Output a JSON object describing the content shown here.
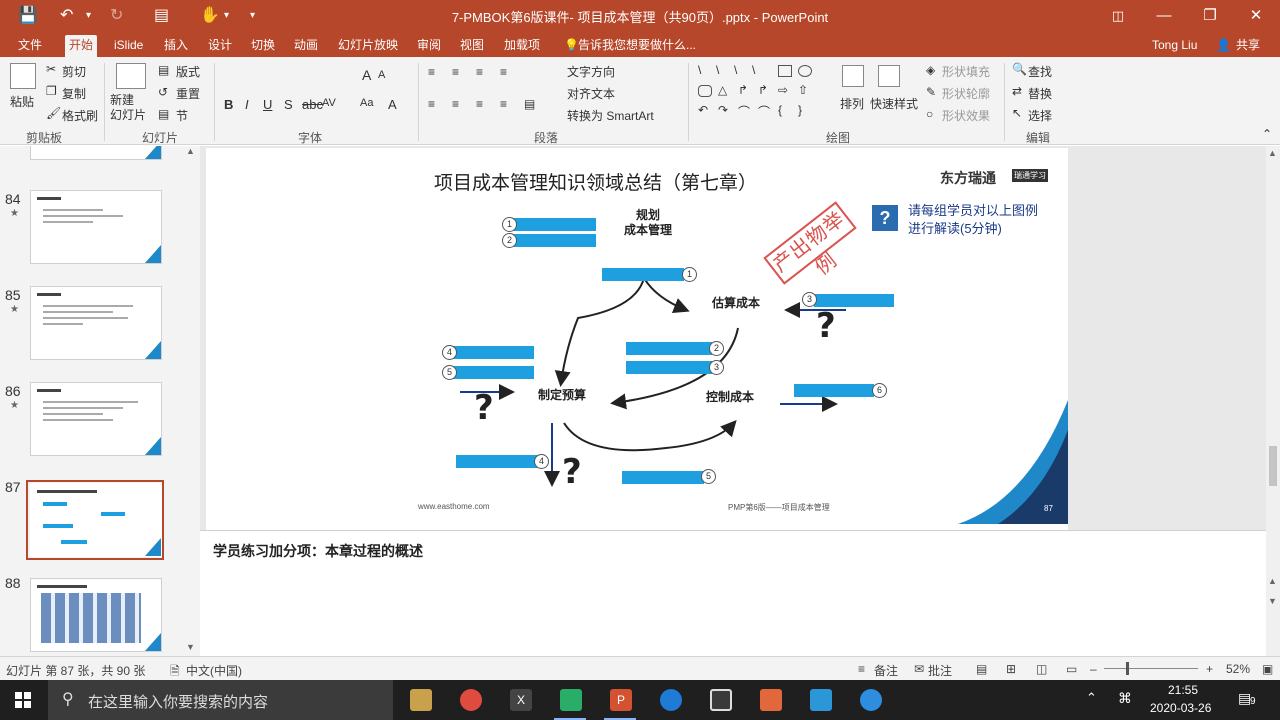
{
  "window": {
    "title": "7-PMBOK第6版课件- 项目成本管理（共90页）.pptx - PowerPoint",
    "user": "Tong Liu",
    "share_label": "共享"
  },
  "tabs": [
    "文件",
    "开始",
    "iSlide",
    "插入",
    "设计",
    "切换",
    "动画",
    "幻灯片放映",
    "审阅",
    "视图",
    "加载项"
  ],
  "tell_me": "告诉我您想要做什么...",
  "ribbon": {
    "clipboard": {
      "paste": "粘贴",
      "cut": "剪切",
      "copy": "复制",
      "format_painter": "格式刷",
      "label": "剪贴板"
    },
    "slides": {
      "new_slide": "新建\n幻灯片",
      "layout": "版式",
      "reset": "重置",
      "section": "节",
      "label": "幻灯片"
    },
    "font": {
      "label": "字体"
    },
    "paragraph": {
      "text_direction": "文字方向",
      "align_text": "对齐文本",
      "smartart": "转换为 SmartArt",
      "label": "段落"
    },
    "drawing": {
      "arrange": "排列",
      "quick_styles": "快速样式",
      "shape_fill": "形状填充",
      "shape_outline": "形状轮廓",
      "shape_effects": "形状效果",
      "label": "绘图"
    },
    "editing": {
      "find": "查找",
      "replace": "替换",
      "select": "选择",
      "label": "编辑"
    }
  },
  "thumbnails": [
    {
      "num": "84",
      "star": "★"
    },
    {
      "num": "85",
      "star": "★"
    },
    {
      "num": "86",
      "star": "★"
    },
    {
      "num": "87",
      "star": "",
      "selected": true
    },
    {
      "num": "88",
      "star": ""
    }
  ],
  "slide": {
    "title": "项目成本管理知识领域总结（第七章）",
    "logo": "东方瑞通",
    "logo_sub": "瑞通学习",
    "prompt": "请每组学员对以上图例\n进行解读(5分钟)",
    "stamp": "产出物举例",
    "process_plan": "规划\n成本管理",
    "process_estimate": "估算成本",
    "process_budget": "制定预算",
    "process_control": "控制成本",
    "website": "www.easthome.com",
    "footer": "PMP第6版——项目成本管理",
    "page": "87"
  },
  "notes": "学员练习加分项：本章过程的概述",
  "status": {
    "slide_info": "幻灯片 第 87 张，共 90 张",
    "language": "中文(中国)",
    "notes_btn": "备注",
    "comments_btn": "批注",
    "zoom": "52%"
  },
  "taskbar": {
    "search_placeholder": "在这里输入你要搜索的内容",
    "time": "21:55",
    "date": "2020-03-26",
    "notification_count": "9"
  }
}
